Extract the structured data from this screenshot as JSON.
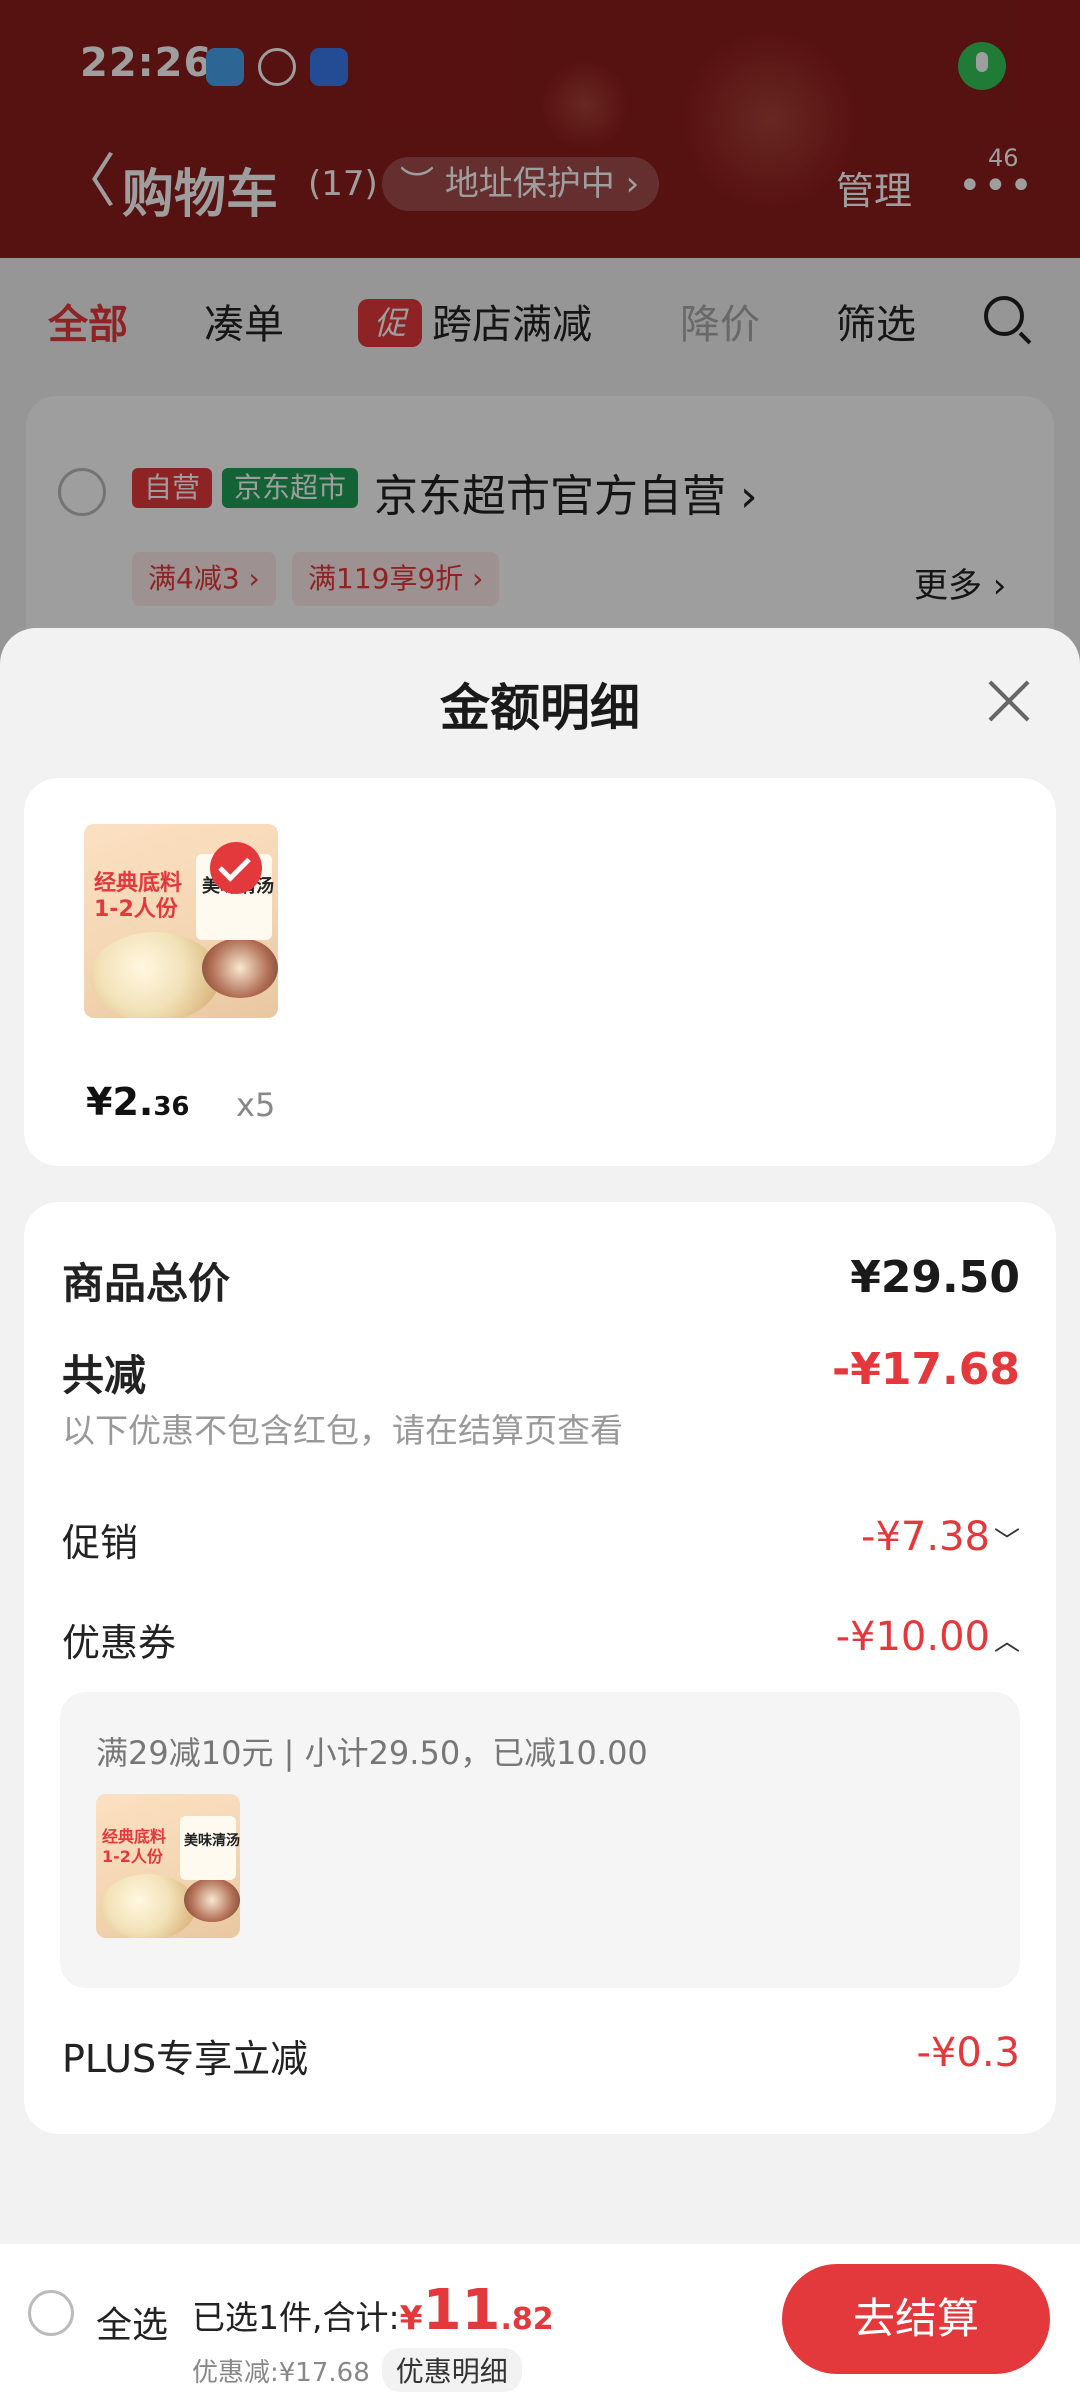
{
  "status_bar": {
    "time": "22:26"
  },
  "nav": {
    "back_glyph": "〈",
    "title": "购物车",
    "count": "(17)",
    "address_pill": "地址保护中",
    "manage": "管理",
    "more_badge": "46"
  },
  "tabs": {
    "all": "全部",
    "combine": "凑单",
    "promo_tag": "促",
    "cross_store": "跨店满减",
    "price_drop": "降价",
    "filter": "筛选"
  },
  "store": {
    "self_tag": "自营",
    "jd_tag": "京东超市",
    "name": "京东超市官方自营",
    "coupon1": "满4减3",
    "coupon2": "满119享9折",
    "more": "更多"
  },
  "sheet": {
    "title": "金额明细",
    "product": {
      "image_text_red": "经典底料",
      "image_text_red2": "1-2人份",
      "image_text_bag": "美味清汤",
      "price_int": "¥2.",
      "price_dec": "36",
      "qty": "x5"
    },
    "total_label": "商品总价",
    "total_value": "¥29.50",
    "reduce_label": "共减",
    "reduce_value": "-¥17.68",
    "note": "以下优惠不包含红包，请在结算页查看",
    "promo_label": "促销",
    "promo_value": "-¥7.38",
    "coupon_label": "优惠券",
    "coupon_value": "-¥10.00",
    "coupon_detail": "满29减10元 | 小计29.50，已减10.00",
    "plus_label": "PLUS专享立减",
    "plus_value": "-¥0.3"
  },
  "bottom": {
    "select_all": "全选",
    "summary_prefix": "已选1件,合计:",
    "total_symbol": "¥",
    "total_int": "11",
    "total_dec": ".82",
    "discount_text": "优惠减:¥17.68",
    "discount_detail_btn": "优惠明细",
    "checkout_btn": "去结算"
  },
  "colors": {
    "header_red": "#8c1c1c",
    "accent_red": "#e4393c",
    "green_tag": "#1fa05a"
  }
}
